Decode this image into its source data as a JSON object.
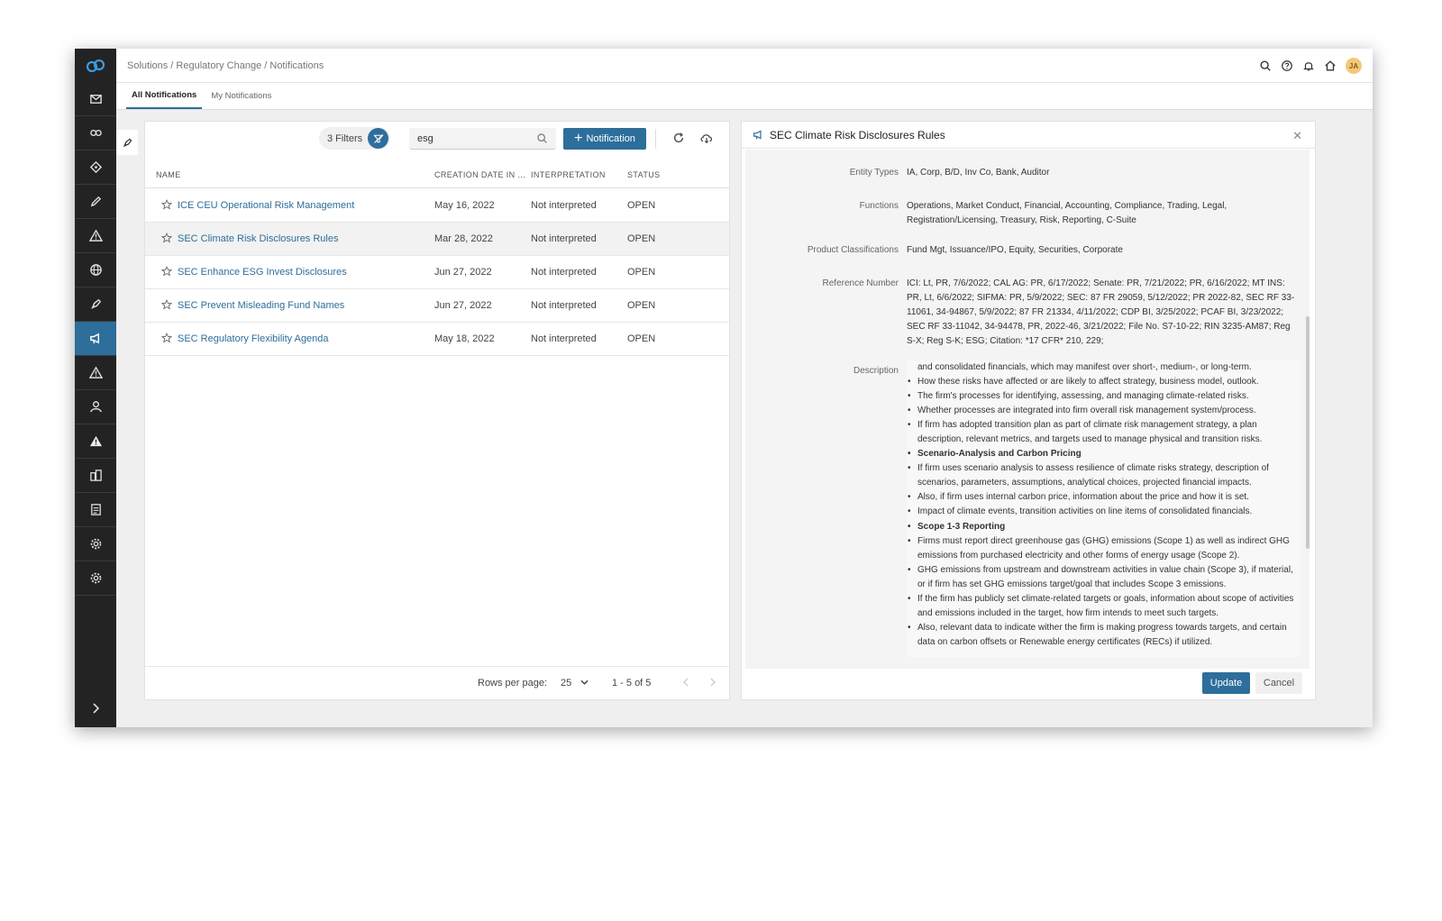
{
  "breadcrumb": "Solutions / Regulatory Change / Notifications",
  "user_initials": "JA",
  "tabs": [
    {
      "label": "All Notifications",
      "active": true
    },
    {
      "label": "My Notifications",
      "active": false
    }
  ],
  "toolbar": {
    "filters_label": "3 Filters",
    "search_value": "esg",
    "add_label": "Notification"
  },
  "table": {
    "headers": {
      "name": "NAME",
      "date": "CREATION DATE IN ...",
      "interp": "INTERPRETATION",
      "status": "STATUS"
    },
    "rows": [
      {
        "name": "ICE CEU Operational Risk Management",
        "date": "May 16, 2022",
        "interp": "Not interpreted",
        "status": "OPEN"
      },
      {
        "name": "SEC Climate Risk Disclosures Rules",
        "date": "Mar 28, 2022",
        "interp": "Not interpreted",
        "status": "OPEN"
      },
      {
        "name": "SEC Enhance ESG Invest Disclosures",
        "date": "Jun 27, 2022",
        "interp": "Not interpreted",
        "status": "OPEN"
      },
      {
        "name": "SEC Prevent Misleading Fund Names",
        "date": "Jun 27, 2022",
        "interp": "Not interpreted",
        "status": "OPEN"
      },
      {
        "name": "SEC Regulatory Flexibility Agenda",
        "date": "May 18, 2022",
        "interp": "Not interpreted",
        "status": "OPEN"
      }
    ],
    "footer": {
      "rows_per_page_label": "Rows per page:",
      "rows_per_page": "25",
      "range": "1 - 5 of 5"
    }
  },
  "detail": {
    "title": "SEC Climate Risk Disclosures Rules",
    "fields": {
      "entity_types": {
        "label": "Entity Types",
        "value": "IA, Corp, B/D, Inv Co, Bank, Auditor"
      },
      "functions": {
        "label": "Functions",
        "value": "Operations, Market Conduct, Financial, Accounting, Compliance, Trading, Legal, Registration/Licensing, Treasury, Risk, Reporting, C-Suite"
      },
      "product_classifications": {
        "label": "Product Classifications",
        "value": "Fund Mgt, Issuance/IPO, Equity, Securities, Corporate"
      },
      "reference_number": {
        "label": "Reference Number",
        "value": "ICI: Lt, PR, 7/6/2022; CAL AG: PR, 6/17/2022; Senate: PR, 7/21/2022; PR, 6/16/2022; MT INS: PR, Lt, 6/6/2022; SIFMA: PR, 5/9/2022; SEC: 87 FR 29059, 5/12/2022; PR 2022-82, SEC RF 33-11061, 34-94867, 5/9/2022; 87 FR 21334, 4/11/2022; CDP BI, 3/25/2022; PCAF BI, 3/23/2022; SEC RF 33-11042, 34-94478, PR, 2022-46, 3/21/2022; File No. S7-10-22; RIN 3235-AM87; Reg S-X; Reg S-K; ESG; Citation: *17 CFR* 210, 229;"
      },
      "description": {
        "label": "Description"
      }
    },
    "description": {
      "lead": "and consolidated financials, which may manifest over short-, medium-, or long-term.",
      "items": [
        "How these risks have affected or are likely to affect strategy, business model, outlook.",
        "The firm's processes for identifying, assessing, and managing climate-related risks.",
        "Whether processes are integrated into firm overall risk management system/process.",
        "If firm has adopted transition plan as part of climate risk management strategy, a plan description, relevant metrics, and targets used to manage physical and transition risks.",
        "Scenario-Analysis and Carbon Pricing",
        "If firm uses scenario analysis to assess resilience of climate risks strategy, description of scenarios, parameters, assumptions, analytical choices, projected financial impacts.",
        "Also, if firm uses internal carbon price, information about the price and how it is set.",
        "Impact of climate events, transition activities on line items of consolidated financials.",
        "Scope 1-3 Reporting",
        "Firms must report direct greenhouse gas (GHG) emissions (Scope 1) as well as indirect GHG emissions from purchased electricity and other forms of energy usage (Scope 2).",
        "GHG emissions from upstream and downstream activities in value chain (Scope 3), if material, or if firm has set GHG emissions target/goal that includes Scope 3 emissions.",
        "If the firm has publicly set climate-related targets or goals, information about scope of activities and emissions included in the target, how firm intends to meet such targets.",
        "Also, relevant data to indicate wither the firm is making progress towards targets, and certain data on carbon offsets or Renewable energy certificates (RECs) if utilized."
      ]
    },
    "update_label": "Update",
    "cancel_label": "Cancel"
  },
  "colors": {
    "accent": "#2d6e9b",
    "sidebar": "#232323",
    "link": "#2d6e9b"
  },
  "icons": [
    "logo-icon",
    "mail-icon",
    "infinity-icon",
    "diamond-icon",
    "pencil-icon",
    "warning-icon",
    "globe-icon",
    "pin-icon",
    "megaphone-icon",
    "alert-icon",
    "person-icon",
    "filled-warning-icon",
    "buildings-icon",
    "document-icon",
    "gear-icon",
    "gear-icon-2",
    "chevron-right-icon",
    "search-icon",
    "help-icon",
    "bell-icon",
    "home-icon",
    "refresh-icon",
    "cloud-download-icon",
    "star-icon",
    "close-icon"
  ]
}
